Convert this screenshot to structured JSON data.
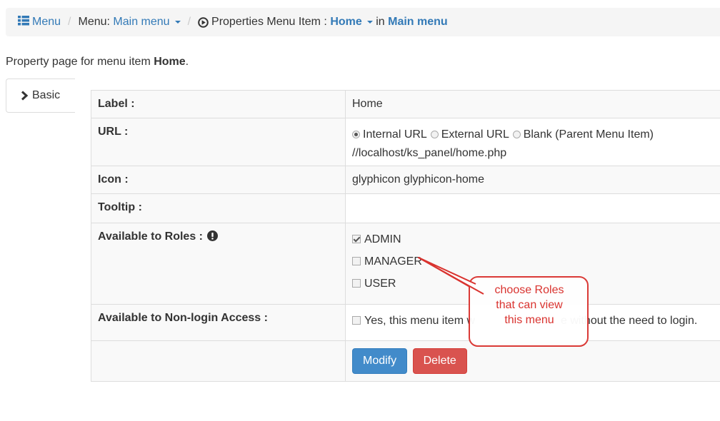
{
  "breadcrumb": {
    "menu_label": "Menu",
    "menu_prefix": "Menu:",
    "menu_name": "Main menu",
    "properties_label": "Properties Menu Item :",
    "item_name": "Home",
    "in_label": "in",
    "menu_target": "Main menu"
  },
  "intro": {
    "text": "Property page for menu item ",
    "item": "Home",
    "end": "."
  },
  "tabs": {
    "basic": "Basic"
  },
  "table": {
    "label_key": "Label :",
    "label_value": "Home",
    "url_key": "URL :",
    "url_options": [
      "Internal URL",
      "External URL",
      "Blank (Parent Menu Item)"
    ],
    "url_value": "//localhost/ks_panel/home.php",
    "icon_key": "Icon :",
    "icon_value": "glyphicon glyphicon-home",
    "tooltip_key": "Tooltip :",
    "tooltip_value": "",
    "roles_key": "Available to Roles :",
    "roles": [
      {
        "name": "ADMIN",
        "checked": true
      },
      {
        "name": "MANAGER",
        "checked": false
      },
      {
        "name": "USER",
        "checked": false
      }
    ],
    "nonlogin_key": "Available to Non-login Access :",
    "nonlogin_value_start": "Yes, this menu item w",
    "nonlogin_value_end": "e without the need to login."
  },
  "buttons": {
    "modify": "Modify",
    "delete": "Delete"
  },
  "callout": {
    "line1": "choose Roles",
    "line2": "that can view",
    "line3": "this menu",
    "color": "#d9332f"
  },
  "colors": {
    "link": "#337ab7",
    "primary": "#428bca",
    "danger": "#d9534f"
  }
}
